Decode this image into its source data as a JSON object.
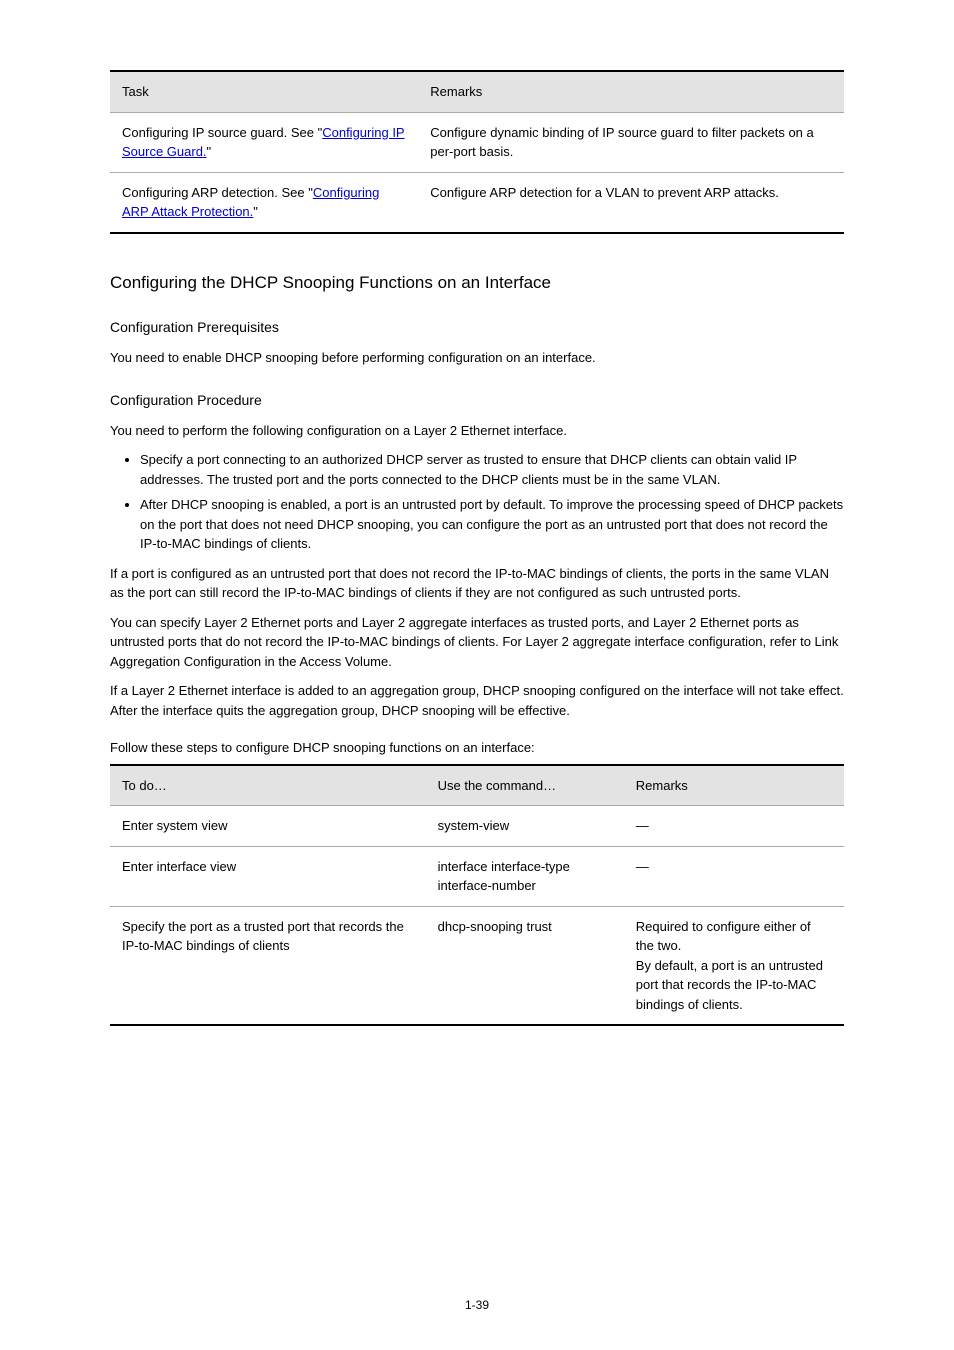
{
  "table1": {
    "headers": [
      "Task",
      "Remarks"
    ],
    "rows": [
      {
        "task_prefix": "Configuring IP source guard. See \"",
        "task_link": "Configuring IP Source Guard.",
        "task_suffix": "\"",
        "remarks": "Configure dynamic binding of IP source guard to filter packets on a per-port basis."
      },
      {
        "task_prefix": "Configuring ARP detection. See \"",
        "task_link": "Configuring ARP Attack Protection.",
        "task_suffix": "\"",
        "remarks": "Configure ARP detection for a VLAN to prevent ARP attacks."
      }
    ]
  },
  "section": {
    "title": "Configuring the DHCP Snooping Functions on an Interface",
    "sub1": {
      "title": "Configuration Prerequisites",
      "para": "You need to enable DHCP snooping before performing configuration on an interface."
    },
    "sub2": {
      "title": "Configuration Procedure",
      "intro": "You need to perform the following configuration on a Layer 2 Ethernet interface.",
      "bullets": [
        "Specify a port connecting to an authorized DHCP server as trusted to ensure that DHCP clients can obtain valid IP addresses. The trusted port and the ports connected to the DHCP clients must be in the same VLAN.",
        "After DHCP snooping is enabled, a port is an untrusted port by default. To improve the processing speed of DHCP packets on the port that does not need DHCP snooping, you can configure the port as an untrusted port that does not record the IP-to-MAC bindings of clients."
      ],
      "para2_1": "If a port is configured as an untrusted port that does not record the IP-to-MAC bindings of clients, the ports in the same VLAN as the port can still record the IP-to-MAC bindings of clients if they are not configured as such untrusted ports.",
      "para2_2": "You can specify Layer 2 Ethernet ports and Layer 2 aggregate interfaces as trusted ports, and Layer 2 Ethernet ports as untrusted ports that do not record the IP-to-MAC bindings of clients. For Layer 2 aggregate interface configuration, refer to Link Aggregation Configuration in the Access Volume.",
      "para2_3": "If a Layer 2 Ethernet interface is added to an aggregation group, DHCP snooping configured on the interface will not take effect. After the interface quits the aggregation group, DHCP snooping will be effective.",
      "para2_4": "Follow these steps to configure DHCP snooping functions on an interface:"
    }
  },
  "table2": {
    "headers": [
      "To do…",
      "Use the command…",
      "Remarks"
    ],
    "rows": [
      {
        "todo": "Enter system view",
        "cmd": "system-view",
        "remarks": "—"
      },
      {
        "todo": "Enter interface view",
        "cmd": "interface interface-type interface-number",
        "remarks": "—"
      },
      {
        "todo": "Specify the port as a trusted port that records the IP-to-MAC bindings of clients",
        "cmd": "dhcp-snooping trust",
        "remarks": "Required to configure either of the two.\nBy default, a port is an untrusted port that records the IP-to-MAC bindings of clients."
      }
    ]
  },
  "page_number": "1-39"
}
